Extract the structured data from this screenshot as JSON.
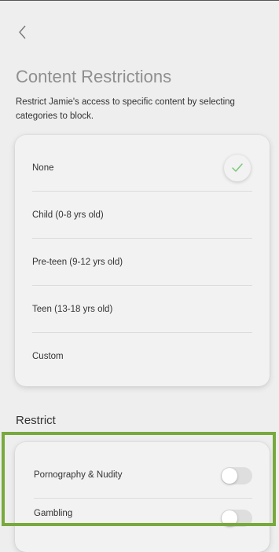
{
  "page": {
    "title": "Content Restrictions",
    "description": "Restrict Jamie's access to specific content by selecting categories to block."
  },
  "options": [
    {
      "label": "None",
      "selected": true
    },
    {
      "label": "Child (0-8 yrs old)",
      "selected": false
    },
    {
      "label": "Pre-teen (9-12 yrs old)",
      "selected": false
    },
    {
      "label": "Teen (13-18 yrs old)",
      "selected": false
    },
    {
      "label": "Custom",
      "selected": false
    }
  ],
  "restrict": {
    "title": "Restrict",
    "items": [
      {
        "label": "Pornography & Nudity",
        "enabled": false
      },
      {
        "label": "Gambling",
        "enabled": false
      }
    ]
  },
  "colors": {
    "check": "#7cc77a",
    "highlight_frame": "#78a93d",
    "toggle_off": "#dedede"
  },
  "icons": {
    "back": "chevron-left-icon",
    "selected": "checkmark-icon"
  }
}
